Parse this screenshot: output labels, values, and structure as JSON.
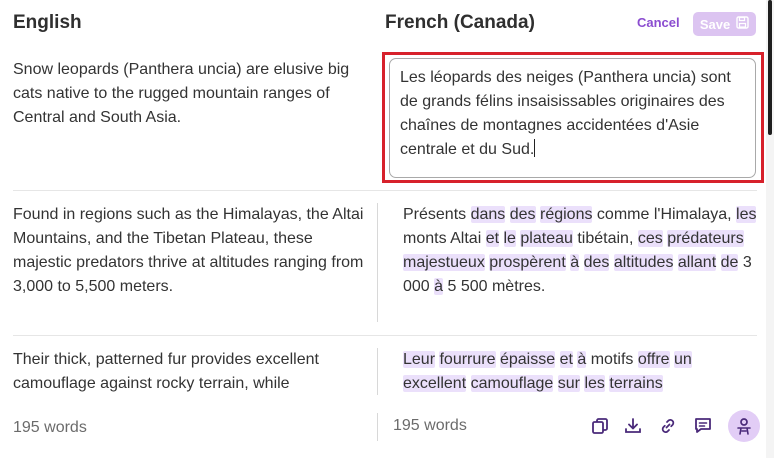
{
  "header": {
    "source_lang": "English",
    "target_lang": "French (Canada)",
    "cancel_label": "Cancel",
    "save_label": "Save"
  },
  "rows": [
    {
      "en": "Snow leopards (Panthera uncia) are elusive big cats native to the rugged mountain ranges of Central and South Asia.",
      "fr": "Les léopards des neiges (Panthera uncia) sont de grands félins insaisissables originaires des chaînes de montagnes accidentées d'Asie centrale et du Sud."
    },
    {
      "en": "Found in regions such as the Himalayas, the Altai Mountains, and the Tibetan Plateau, these majestic predators thrive at altitudes ranging from 3,000 to 5,500 meters.",
      "fr_segments": [
        "Présents ",
        "dans",
        " ",
        "des",
        " ",
        "régions",
        " comme l'Himalaya, ",
        "les",
        " monts Altai ",
        "et",
        " ",
        "le",
        " ",
        "plateau",
        " tibétain, ",
        "ces",
        " ",
        "prédateurs",
        " ",
        "majestueux",
        " ",
        "prospèrent",
        " ",
        "à",
        " ",
        "des",
        " ",
        "altitudes",
        " ",
        "allant",
        " ",
        "de",
        " 3 000 ",
        "à",
        " 5 500 mètres."
      ]
    },
    {
      "en": "Their thick, patterned fur provides excellent camouflage against rocky terrain, while",
      "fr_segments": [
        "Leur",
        " ",
        "fourrure",
        " ",
        "épaisse",
        " ",
        "et",
        " ",
        "à",
        " motifs ",
        "offre",
        " ",
        "un",
        " ",
        "excellent",
        " ",
        "camouflage",
        " ",
        "sur",
        " ",
        "les",
        " ",
        "terrains"
      ]
    }
  ],
  "footer": {
    "source_word_count": "195 words",
    "target_word_count": "195 words"
  },
  "icons": [
    "copy-icon",
    "download-icon",
    "link-icon",
    "comment-icon",
    "profile-assistant-icon"
  ],
  "colors": {
    "accent": "#8b4dd0",
    "highlight": "#ebe0fb",
    "focus_outline": "#d7212b"
  }
}
